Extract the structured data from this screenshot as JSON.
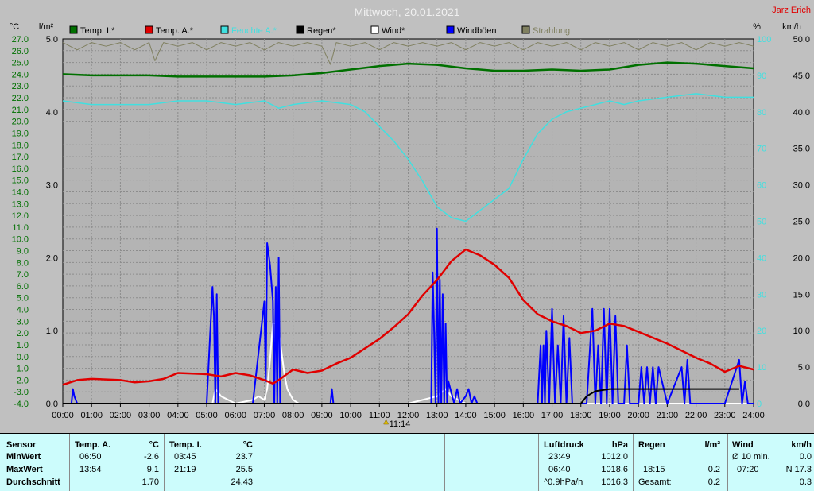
{
  "chart_data": {
    "type": "line",
    "title": "Mittwoch, 20.01.2021",
    "author": "Jarz Erich",
    "units": {
      "temp": "°C",
      "rain": "l/m²",
      "humidity": "%",
      "wind": "km/h"
    },
    "xlabels": [
      "00:00",
      "01:00",
      "02:00",
      "03:00",
      "04:00",
      "05:00",
      "06:00",
      "07:00",
      "08:00",
      "09:00",
      "10:00",
      "11:00",
      "12:00",
      "13:00",
      "14:00",
      "15:00",
      "16:00",
      "17:00",
      "18:00",
      "19:00",
      "20:00",
      "21:00",
      "22:00",
      "23:00",
      "24:00"
    ],
    "x_range_hours": [
      0,
      24
    ],
    "marker_label": "11:14",
    "marker_hour": 11.23,
    "temp_axis": {
      "min": -4,
      "max": 27,
      "ticks": [
        "27.0",
        "26.0",
        "25.0",
        "24.0",
        "23.0",
        "22.0",
        "21.0",
        "20.0",
        "19.0",
        "18.0",
        "17.0",
        "16.0",
        "15.0",
        "14.0",
        "13.0",
        "12.0",
        "11.0",
        "10.0",
        "9.0",
        "8.0",
        "7.0",
        "6.0",
        "5.0",
        "4.0",
        "3.0",
        "2.0",
        "1.0",
        "0.0",
        "-1.0",
        "-2.0",
        "-3.0",
        "-4.0"
      ]
    },
    "rain_axis": {
      "min": 0,
      "max": 5,
      "ticks": [
        "5.0",
        "4.0",
        "3.0",
        "2.0",
        "1.0",
        "0.0"
      ]
    },
    "humidity_axis": {
      "min": 0,
      "max": 100,
      "ticks": [
        "100",
        "90",
        "80",
        "70",
        "60",
        "50",
        "40",
        "30",
        "20",
        "10",
        "0"
      ]
    },
    "wind_axis": {
      "min": 0,
      "max": 50,
      "ticks": [
        "50.0",
        "45.0",
        "40.0",
        "35.0",
        "30.0",
        "25.0",
        "20.0",
        "15.0",
        "10.0",
        "5.0",
        "0.0"
      ]
    },
    "grid": true,
    "legend": [
      {
        "name": "Temp. I.*",
        "color": "#007000"
      },
      {
        "name": "Temp. A.*",
        "color": "#e00000"
      },
      {
        "name": "Feuchte A.*",
        "color": "#40e0e0"
      },
      {
        "name": "Regen*",
        "color": "#000000"
      },
      {
        "name": "Wind*",
        "color": "#ffffff"
      },
      {
        "name": "Windböen",
        "color": "#0000ff"
      },
      {
        "name": "Strahlung",
        "color": "#808060"
      }
    ],
    "series": [
      {
        "name": "Temp. I.*",
        "axis": "temp",
        "color": "#007000",
        "x": [
          0,
          1,
          2,
          3,
          4,
          5,
          6,
          7,
          8,
          9,
          10,
          11,
          12,
          13,
          14,
          15,
          16,
          17,
          18,
          19,
          20,
          21,
          22,
          23,
          24
        ],
        "y": [
          24.0,
          23.9,
          23.9,
          23.9,
          23.8,
          23.8,
          23.8,
          23.8,
          23.9,
          24.1,
          24.4,
          24.7,
          24.9,
          24.8,
          24.5,
          24.3,
          24.3,
          24.4,
          24.3,
          24.4,
          24.8,
          25.0,
          24.9,
          24.7,
          24.5
        ]
      },
      {
        "name": "Temp. A.*",
        "axis": "temp",
        "color": "#e00000",
        "x": [
          0,
          0.5,
          1,
          2,
          2.5,
          3,
          3.5,
          4,
          5,
          5.5,
          6,
          6.5,
          7,
          7.3,
          7.5,
          8,
          8.5,
          9,
          9.5,
          10,
          10.5,
          11,
          11.5,
          12,
          12.5,
          13,
          13.5,
          14,
          14.5,
          15,
          15.5,
          16,
          16.5,
          17,
          17.5,
          18,
          18.5,
          19,
          19.5,
          20,
          20.5,
          21,
          21.5,
          22,
          22.5,
          23,
          23.5,
          24
        ],
        "y": [
          -2.4,
          -2.0,
          -1.9,
          -2.0,
          -2.2,
          -2.1,
          -1.9,
          -1.4,
          -1.5,
          -1.7,
          -1.4,
          -1.6,
          -2.0,
          -2.3,
          -2.0,
          -1.1,
          -1.4,
          -1.2,
          -0.6,
          -0.1,
          0.7,
          1.5,
          2.5,
          3.6,
          5.2,
          6.5,
          8.1,
          9.1,
          8.6,
          7.8,
          6.7,
          4.8,
          3.6,
          3.0,
          2.6,
          2.0,
          2.2,
          2.8,
          2.6,
          2.1,
          1.6,
          1.1,
          0.5,
          -0.1,
          -0.6,
          -1.3,
          -0.8,
          -1.1
        ]
      },
      {
        "name": "Feuchte A.*",
        "axis": "humidity",
        "color": "#40e0e0",
        "x": [
          0,
          1,
          2,
          3,
          4,
          5,
          6,
          7,
          7.5,
          8,
          9,
          10,
          10.5,
          11,
          11.5,
          12,
          12.5,
          13,
          13.5,
          14,
          14.5,
          15,
          15.5,
          16,
          16.5,
          17,
          17.5,
          18,
          18.5,
          19,
          19.5,
          20,
          21,
          22,
          23,
          24
        ],
        "y": [
          83,
          82,
          82,
          82,
          83,
          83,
          82,
          83,
          81,
          82,
          83,
          82,
          80,
          76,
          72,
          67,
          61,
          54,
          51,
          50,
          53,
          56,
          59,
          67,
          74,
          78,
          80,
          81,
          82,
          83,
          82,
          83,
          84,
          85,
          84,
          84
        ]
      },
      {
        "name": "Regen*",
        "axis": "rain",
        "color": "#000000",
        "x": [
          0,
          18,
          18.2,
          18.5,
          19,
          20,
          21,
          22,
          23,
          23.5
        ],
        "y": [
          0,
          0,
          0.1,
          0.17,
          0.2,
          0.2,
          0.2,
          0.2,
          0.2,
          0.2
        ]
      },
      {
        "name": "Wind*",
        "axis": "wind",
        "color": "#ffffff",
        "x": [
          0,
          5.2,
          5.3,
          5.5,
          6,
          6.6,
          6.8,
          7.0,
          7.1,
          7.2,
          7.3,
          7.4,
          7.5,
          7.6,
          7.7,
          7.8,
          8.0,
          8.2,
          9,
          12,
          12.5,
          13,
          13.3,
          13.5,
          14,
          16,
          23.5,
          24
        ],
        "y": [
          0,
          0,
          2,
          1,
          0,
          0.5,
          1,
          0.5,
          2,
          6,
          11,
          11,
          10,
          7,
          4,
          2,
          0.5,
          0,
          0,
          0,
          0.5,
          1,
          2,
          1,
          0,
          0,
          0,
          0
        ]
      },
      {
        "name": "Windböen",
        "axis": "wind",
        "color": "#0000ff",
        "x": [
          0,
          0.3,
          0.35,
          0.4,
          0.5,
          5,
          5.2,
          5.25,
          5.3,
          5.35,
          5.4,
          5.5,
          6.6,
          7.0,
          7.05,
          7.1,
          7.2,
          7.3,
          7.35,
          7.4,
          7.45,
          7.5,
          7.55,
          7.6,
          7.7,
          7.8,
          8.0,
          9.3,
          9.35,
          9.4,
          9.5,
          12.8,
          12.85,
          12.9,
          12.95,
          13.0,
          13.05,
          13.1,
          13.15,
          13.2,
          13.25,
          13.3,
          13.35,
          13.4,
          13.6,
          13.7,
          13.8,
          14.0,
          14.1,
          14.2,
          14.3,
          14.4,
          14.5,
          16.5,
          16.6,
          16.65,
          16.7,
          16.75,
          16.8,
          16.9,
          17.0,
          17.1,
          17.2,
          17.3,
          17.4,
          17.5,
          17.6,
          17.7,
          18.0,
          18.2,
          18.4,
          18.5,
          18.6,
          18.7,
          18.8,
          18.9,
          19.0,
          19.1,
          19.2,
          19.3,
          19.5,
          19.6,
          19.7,
          19.8,
          20.0,
          20.1,
          20.2,
          20.3,
          20.4,
          20.5,
          20.6,
          20.7,
          21.0,
          21.5,
          21.6,
          21.7,
          21.8,
          22.5,
          23.0,
          23.5,
          23.6,
          23.7,
          23.8,
          24.0
        ],
        "y": [
          0,
          0,
          2,
          1,
          0,
          0,
          16,
          12,
          0,
          15,
          0,
          0,
          0,
          14,
          3,
          22,
          19,
          14,
          0,
          16,
          0,
          20,
          0,
          0,
          0,
          0,
          0,
          0,
          2,
          0,
          0,
          0,
          18,
          10,
          0,
          24,
          0,
          17,
          0,
          15,
          0,
          11,
          0,
          3,
          0,
          2,
          0,
          1,
          2,
          0,
          1,
          0,
          0,
          0,
          8,
          0,
          8,
          0,
          10,
          0,
          13,
          0,
          8,
          0,
          12,
          0,
          9,
          0,
          0,
          0,
          13,
          0,
          8,
          0,
          13,
          0,
          13,
          0,
          12,
          0,
          0,
          8,
          0,
          0,
          0,
          5,
          0,
          5,
          0,
          5,
          0,
          5,
          0,
          5,
          0,
          6,
          0,
          0,
          0,
          6,
          0,
          3,
          0,
          0
        ]
      },
      {
        "name": "Strahlung",
        "axis": "humidity",
        "color": "#808060",
        "x": [
          0,
          0.5,
          1,
          1.5,
          2,
          2.5,
          3,
          3.2,
          3.5,
          4,
          4.5,
          5,
          5.5,
          6,
          6.5,
          7,
          7.5,
          8,
          8.5,
          9,
          9.3,
          9.5,
          10,
          10.5,
          11,
          11.5,
          12,
          12.5,
          13,
          13.5,
          14,
          14.5,
          15,
          15.5,
          16,
          16.5,
          17,
          17.5,
          18,
          18.5,
          19,
          19.5,
          20,
          20.5,
          21,
          21.5,
          22,
          22.5,
          23,
          23.5,
          24
        ],
        "y": [
          99,
          97,
          99,
          98,
          99,
          97,
          99,
          94,
          99,
          98,
          99,
          97,
          99,
          98,
          99,
          97,
          99,
          98,
          99,
          98,
          93,
          99,
          98,
          99,
          97,
          99,
          98,
          99,
          98,
          99,
          97,
          99,
          98,
          99,
          97,
          99,
          98,
          99,
          97,
          99,
          98,
          99,
          97,
          99,
          98,
          99,
          97,
          99,
          98,
          99,
          98
        ]
      }
    ]
  },
  "summary": {
    "sensor_header": "Sensor",
    "row_labels": [
      "MinWert",
      "MaxWert",
      "Durchschnitt"
    ],
    "temp_a": {
      "header": "Temp. A.",
      "unit": "°C",
      "min_time": "06:50",
      "min": "-2.6",
      "max_time": "13:54",
      "max": "9.1",
      "avg": "1.70"
    },
    "temp_i": {
      "header": "Temp. I.",
      "unit": "°C",
      "min_time": "03:45",
      "min": "23.7",
      "max_time": "21:19",
      "max": "25.5",
      "avg": "24.43"
    },
    "pressure": {
      "header": "Luftdruck",
      "unit": "hPa",
      "min_time": "23:49",
      "min": "1012.0",
      "max_time": "06:40",
      "max": "1018.6",
      "trend": "^0.9hPa/h",
      "avg": "1016.3"
    },
    "rain": {
      "header": "Regen",
      "unit": "l/m²",
      "time": "18:15",
      "value": "0.2",
      "total_label": "Gesamt:",
      "total": "0.2"
    },
    "wind": {
      "header": "Wind",
      "unit": "km/h",
      "avg_label": "Ø 10 min.",
      "avg": "0.0",
      "max_time": "07:20",
      "max": "N 17.3",
      "day_avg": "0.3"
    }
  }
}
